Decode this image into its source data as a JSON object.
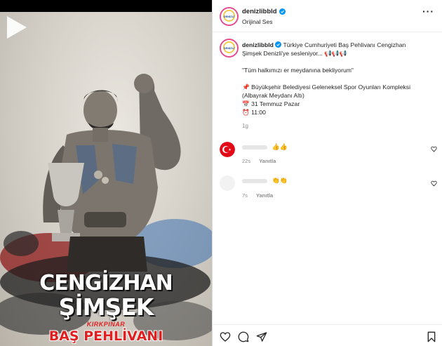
{
  "post": {
    "username": "denizlibbld",
    "audio": "Orijinal Ses",
    "avatar_text": "DENİZLİ",
    "caption": {
      "username": "denizlibbld",
      "line1": "Türkiye Cumhuriyeti Baş Pehlivanı Cengizhan",
      "line2": "Şimşek Denizli'ye sesleniyor... 📢📢📢",
      "quote": "\"Tüm halkımızı er meydanına bekliyorum\"",
      "venue_line1": "📌 Büyükşehir Belediyesi Geleneksel Spor Oyunları Kompleksi",
      "venue_line2": "(Albayrak Meydanı Altı)",
      "date": "📅 31 Temmuz Pazar",
      "time": "⏰ 11:00",
      "age": "1g"
    }
  },
  "poster": {
    "name_first": "CENGİZHAN",
    "name_last": "ŞİMŞEK",
    "subtitle": "KIRKPINAR",
    "title": "BAŞ PEHLİVANI"
  },
  "comments": [
    {
      "text": "👍👍",
      "age": "22s",
      "reply": "Yanıtla"
    },
    {
      "text": "👏👏",
      "age": "7s",
      "reply": "Yanıtla"
    }
  ],
  "icons": {
    "more": "more-options-icon",
    "verified": "verified-badge-icon",
    "play": "play-icon",
    "like": "heart-icon",
    "comment": "comment-icon",
    "share": "share-icon",
    "save": "bookmark-icon"
  },
  "colors": {
    "verified_blue": "#0095f6",
    "poster_red": "#e02020",
    "meta_gray": "#8e8e8e"
  }
}
